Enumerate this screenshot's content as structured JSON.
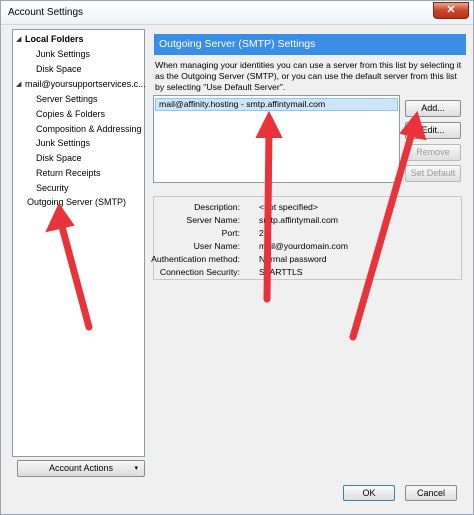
{
  "window": {
    "title": "Account Settings",
    "close_symbol": "✕"
  },
  "tree": {
    "items": [
      {
        "label": "Local Folders",
        "level": 0,
        "bold": true,
        "toggle": "▪"
      },
      {
        "label": "Junk Settings",
        "level": 1
      },
      {
        "label": "Disk Space",
        "level": 1
      },
      {
        "label": "mail@yoursupportservices.c...",
        "level": 0,
        "toggle": "▪"
      },
      {
        "label": "Server Settings",
        "level": 1
      },
      {
        "label": "Copies & Folders",
        "level": 1
      },
      {
        "label": "Composition & Addressing",
        "level": 1
      },
      {
        "label": "Junk Settings",
        "level": 1
      },
      {
        "label": "Disk Space",
        "level": 1
      },
      {
        "label": "Return Receipts",
        "level": 1
      },
      {
        "label": "Security",
        "level": 1
      },
      {
        "label": "Outgoing Server (SMTP)",
        "level": 0
      }
    ]
  },
  "account_actions": {
    "label": "Account Actions",
    "arrow": "▾"
  },
  "panel": {
    "header": "Outgoing Server (SMTP) Settings",
    "description": "When managing your identities you can use a server from this list by selecting it as the Outgoing Server (SMTP), or you can use the default server from this list by selecting \"Use Default Server\".",
    "servers": [
      "mail@affinity.hosting - smtp.affintymail.com"
    ],
    "buttons": {
      "add": "Add...",
      "edit": "Edit...",
      "remove": "Remove",
      "set_default": "Set Default"
    },
    "details": {
      "labels": [
        "Description:",
        "Server Name:",
        "Port:",
        "User Name:",
        "Authentication method:",
        "Connection Security:"
      ],
      "values": [
        "<not specified>",
        "smtp.affintymail.com",
        "25",
        "mail@yourdomain.com",
        "Normal password",
        "STARTTLS"
      ]
    }
  },
  "footer": {
    "ok": "OK",
    "cancel": "Cancel"
  },
  "colors": {
    "annotation_arrow": "#e8333a",
    "header_blue": "#3a8ee6"
  }
}
